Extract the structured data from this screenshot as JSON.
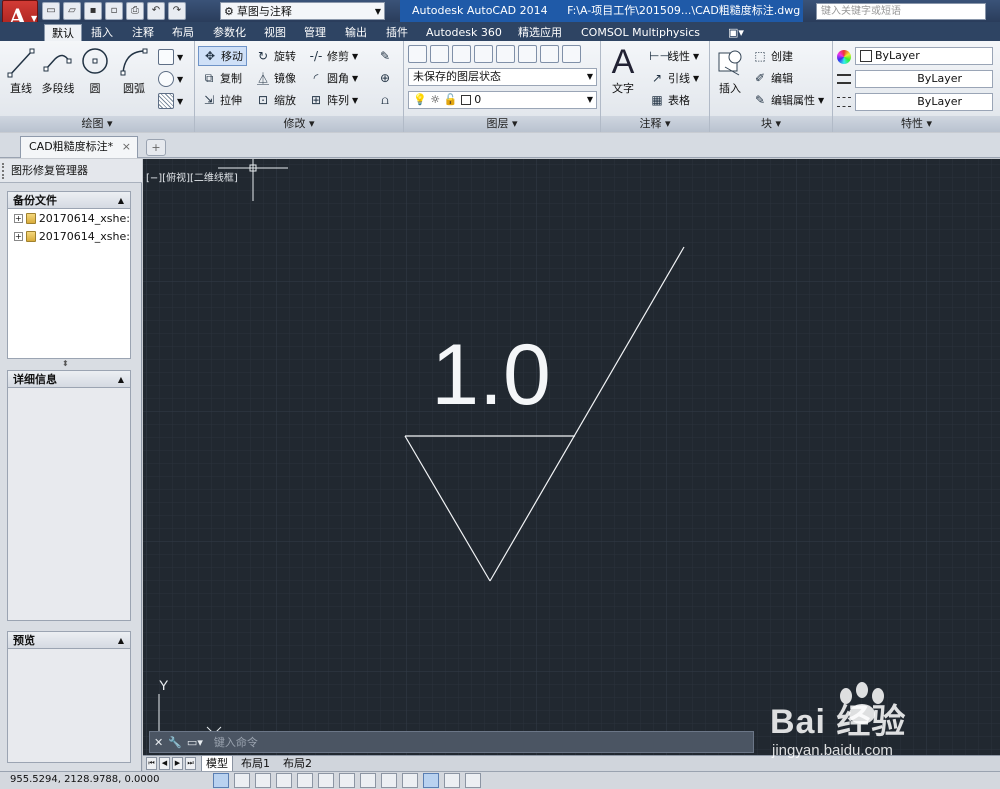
{
  "app": {
    "logo_letter": "A",
    "workspace": "草图与注释",
    "product": "Autodesk AutoCAD 2014",
    "file_path": "F:\\A-项目工作\\201509...\\CAD粗糙度标注.dwg",
    "search_placeholder": "键入关键字或短语"
  },
  "ribbon_tabs": [
    "默认",
    "插入",
    "注释",
    "布局",
    "参数化",
    "视图",
    "管理",
    "输出",
    "插件",
    "Autodesk 360",
    "精选应用",
    "COMSOL Multiphysics"
  ],
  "ribbon": {
    "draw": {
      "title": "绘图",
      "line": "直线",
      "polyline": "多段线",
      "circle": "圆",
      "arc": "圆弧"
    },
    "modify": {
      "title": "修改",
      "move": "移动",
      "rotate": "旋转",
      "trim": "修剪",
      "copy": "复制",
      "mirror": "镜像",
      "fillet": "圆角",
      "stretch": "拉伸",
      "scale": "缩放",
      "array": "阵列"
    },
    "layers": {
      "title": "图层",
      "state": "未保存的图层状态",
      "current": "0"
    },
    "annotation": {
      "title": "注释",
      "text": "文字",
      "linear": "线性",
      "leader": "引线",
      "table": "表格"
    },
    "block": {
      "title": "块",
      "insert": "插入",
      "create": "创建",
      "edit": "编辑",
      "edit_attr": "编辑属性"
    },
    "properties": {
      "title": "特性",
      "color": "ByLayer",
      "linetype": "ByLayer",
      "lineweight": "ByLayer"
    }
  },
  "doc_tab": "CAD粗糙度标注*",
  "left_panel": {
    "title": "图形修复管理器",
    "backup_title": "备份文件",
    "backup_items": [
      "20170614_xshe:",
      "20170614_xshe:"
    ],
    "details_title": "详细信息",
    "preview_title": "预览"
  },
  "canvas": {
    "view_label": "[−][俯视][二维线框]",
    "roughness_value": "1.0",
    "ucs_y": "Y",
    "bg_color": "#212830",
    "line_color": "#f2f4f6"
  },
  "command": {
    "placeholder": "键入命令"
  },
  "layout_tabs": [
    "模型",
    "布局1",
    "布局2"
  ],
  "status": {
    "coords": "955.5294,  2128.9788, 0.0000"
  },
  "watermark": {
    "text": "Bai 经验",
    "url": "jingyan.baidu.com"
  }
}
